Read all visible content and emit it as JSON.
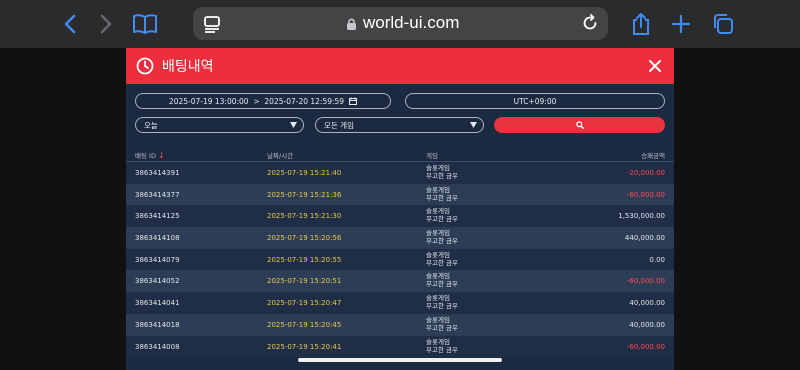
{
  "browser": {
    "url": "world-ui.com"
  },
  "dialog": {
    "title": "배팅내역",
    "date_range": "2025-07-19 13:00:00  >  2025-07-20 12:59:59",
    "timezone": "UTC+09:00",
    "filter_period": "오늘",
    "filter_game": "모든 게임",
    "colors": {
      "header": "#ec2e3e",
      "accent_date": "#e6c84c",
      "negative": "#ff4b55"
    }
  },
  "table": {
    "headers": {
      "id": "배팅 ID",
      "datetime": "날짜/시간",
      "game": "게임",
      "amount": "승패금액"
    },
    "rows": [
      {
        "id": "3863414391",
        "datetime": "2025-07-19 15:21:40",
        "game1": "슬롯게임",
        "game2": "무고한 금우",
        "amount": "-20,000.00",
        "neg": true
      },
      {
        "id": "3863414377",
        "datetime": "2025-07-19 15:21:36",
        "game1": "슬롯게임",
        "game2": "무고한 금우",
        "amount": "-60,000.00",
        "neg": true
      },
      {
        "id": "3863414125",
        "datetime": "2025-07-19 15:21:30",
        "game1": "슬롯게임",
        "game2": "무고한 금우",
        "amount": "1,530,000.00",
        "neg": false
      },
      {
        "id": "3863414108",
        "datetime": "2025-07-19 15:20:56",
        "game1": "슬롯게임",
        "game2": "무고한 금우",
        "amount": "440,000.00",
        "neg": false
      },
      {
        "id": "3863414079",
        "datetime": "2025-07-19 15:20:55",
        "game1": "슬롯게임",
        "game2": "무고한 금우",
        "amount": "0.00",
        "neg": false
      },
      {
        "id": "3863414052",
        "datetime": "2025-07-19 15:20:51",
        "game1": "슬롯게임",
        "game2": "무고한 금우",
        "amount": "-60,000.00",
        "neg": true
      },
      {
        "id": "3863414041",
        "datetime": "2025-07-19 15:20:47",
        "game1": "슬롯게임",
        "game2": "무고한 금우",
        "amount": "40,000.00",
        "neg": false
      },
      {
        "id": "3863414018",
        "datetime": "2025-07-19 15:20:45",
        "game1": "슬롯게임",
        "game2": "무고한 금우",
        "amount": "40,000.00",
        "neg": false
      },
      {
        "id": "3863414008",
        "datetime": "2025-07-19 15:20:41",
        "game1": "슬롯게임",
        "game2": "무고한 금우",
        "amount": "-60,000.00",
        "neg": true
      }
    ]
  }
}
